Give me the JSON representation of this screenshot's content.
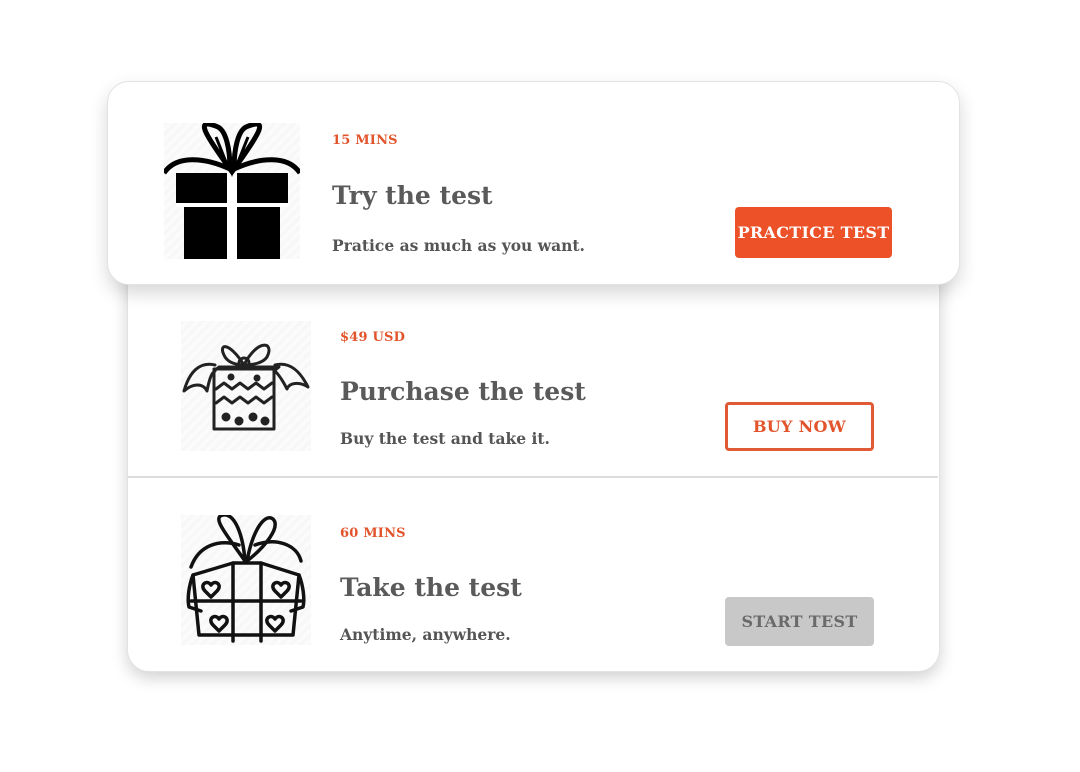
{
  "colors": {
    "accent": "#ec5128",
    "title_text": "#5a5a5a",
    "disabled_button": "#c8c8c8"
  },
  "options": [
    {
      "icon": "gift-box-solid-icon",
      "meta": "15 MINS",
      "title": "Try the test",
      "description": "Pratice as much as you want.",
      "button_label": "PRACTICE TEST",
      "button_style": "primary"
    },
    {
      "icon": "gift-box-patterned-icon",
      "meta": "$49 USD",
      "title": "Purchase the test",
      "description": "Buy the test and take it.",
      "button_label": "BUY NOW",
      "button_style": "outline"
    },
    {
      "icon": "gift-box-hearts-icon",
      "meta": "60 MINS",
      "title": "Take the test",
      "description": "Anytime, anywhere.",
      "button_label": "START TEST",
      "button_style": "disabled"
    }
  ]
}
